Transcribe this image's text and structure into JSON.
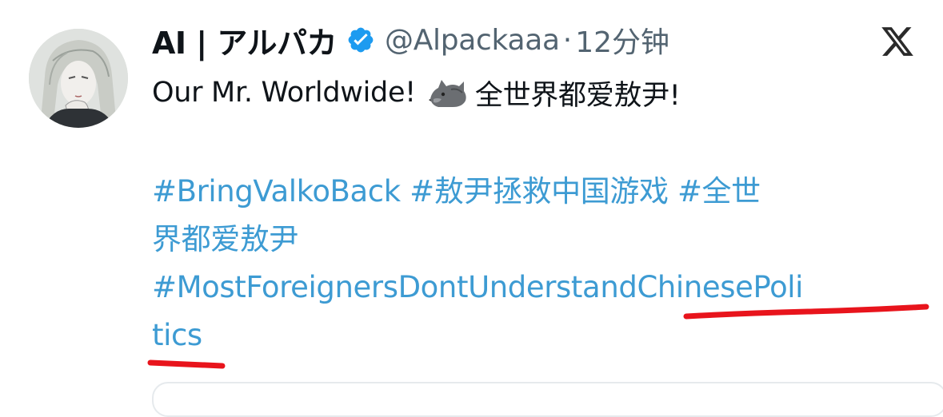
{
  "tweet": {
    "author": {
      "display_name": "AI | アルパカ",
      "handle": "@Alpackaaa",
      "verified": true,
      "avatar_icon": "anime-character-avatar"
    },
    "separator": "·",
    "timestamp": "12分钟",
    "text_before_emoji": "Our Mr. Worldwide!",
    "emoji": "wolf-emoji",
    "text_after_emoji": "全世界都爱敖尹!",
    "hashtags": {
      "line1_a": "#BringValkoBack",
      "line1_b": "#敖尹拯救中国游戏",
      "line1_c": "#全世",
      "line2": "界都爱敖尹",
      "line3": "#MostForeignersDontUnderstandChinesePoli",
      "line4": "tics"
    },
    "annotations": {
      "underline_color": "#e8141c"
    }
  },
  "platform": {
    "logo_icon": "x-logo-icon"
  },
  "colors": {
    "hashtag": "#3d9bd3",
    "verified_badge": "#1d9bf0",
    "secondary_text": "#536471"
  }
}
